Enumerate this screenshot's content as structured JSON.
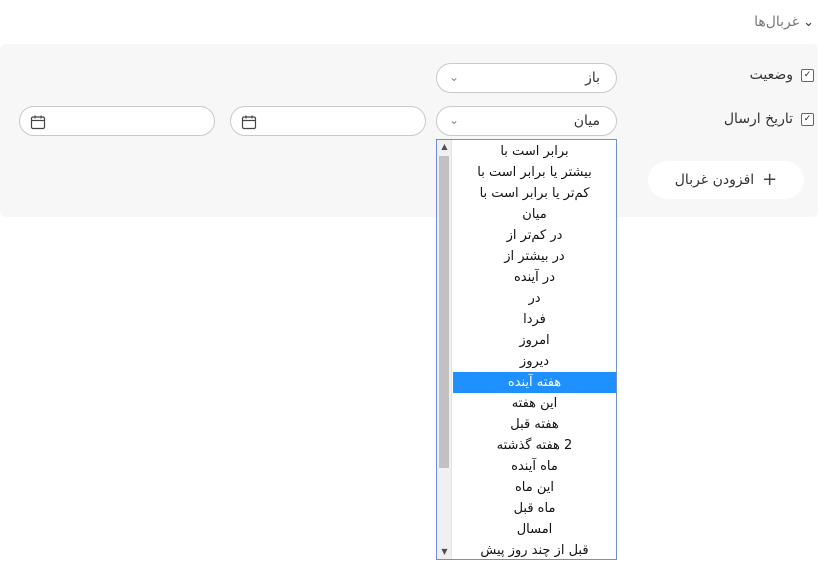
{
  "filters_header": {
    "label": "غربال‌ها"
  },
  "rows": {
    "status": {
      "label": "وضعیت",
      "checked": true,
      "value": "باز"
    },
    "send_date": {
      "label": "تاریخ ارسال",
      "checked": true,
      "operator": "میان"
    }
  },
  "add_filter": {
    "label": "افزودن غربال"
  },
  "dropdown": {
    "options": [
      "برابر است با",
      "بیشتر یا برابر است با",
      "کم‌تر یا برابر است با",
      "میان",
      "در کم‌تر از",
      "در بیشتر از",
      "در آینده",
      "در",
      "فردا",
      "امروز",
      "دیروز",
      "هفته آینده",
      "این هفته",
      "هفته قبل",
      "2 هفته گذشته",
      "ماه آینده",
      "این ماه",
      "ماه قبل",
      "امسال",
      "قبل از چند روز پیش"
    ],
    "highlighted": "هفته آینده"
  },
  "colors": {
    "highlight": "#1e90ff",
    "dropdown_border": "#6e8fd6",
    "panel_bg": "#f7f7f8"
  },
  "icons": {
    "toggle": "chevron-down-icon",
    "select_arrow": "chevron-down-icon",
    "date": "calendar-icon",
    "add": "plus-icon"
  }
}
